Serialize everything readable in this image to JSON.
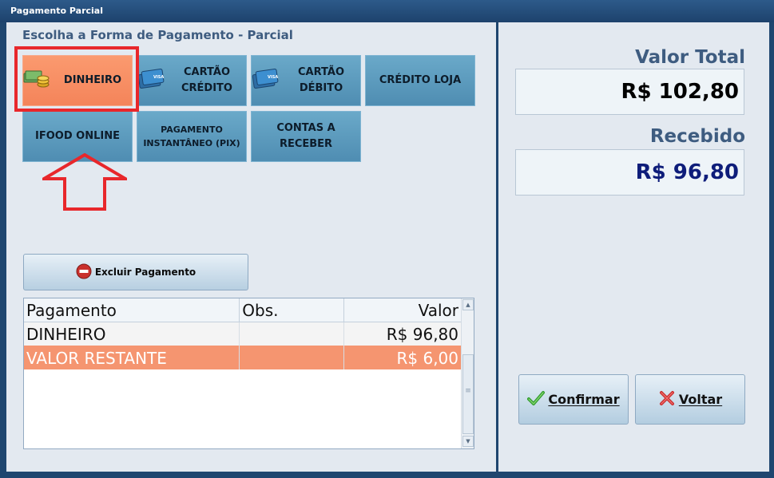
{
  "window": {
    "title": "Pagamento Parcial"
  },
  "section_title": "Escolha a Forma de Pagamento - Parcial",
  "payment_methods": [
    {
      "label": "DINHEIRO",
      "icon": "cash-coins-icon",
      "selected": true
    },
    {
      "label": "CARTÃO CRÉDITO",
      "icon": "credit-card-icon",
      "selected": false
    },
    {
      "label": "CARTÃO DÉBITO",
      "icon": "debit-card-icon",
      "selected": false
    },
    {
      "label": "CRÉDITO LOJA",
      "selected": false
    },
    {
      "label": "IFOOD ONLINE",
      "selected": false
    },
    {
      "label": "PAGAMENTO INSTANTÂNEO (PIX)",
      "selected": false
    },
    {
      "label": "CONTAS A RECEBER",
      "selected": false
    }
  ],
  "excluir_button": {
    "label": "Excluir Pagamento",
    "icon": "remove-circle-icon"
  },
  "table": {
    "headers": [
      "Pagamento",
      "Obs.",
      "Valor"
    ],
    "rows": [
      {
        "pagamento": "DINHEIRO",
        "obs": "",
        "valor": "R$ 96,80"
      },
      {
        "pagamento": "VALOR RESTANTE",
        "obs": "",
        "valor": "R$ 6,00"
      }
    ]
  },
  "totals": {
    "valor_total_label": "Valor Total",
    "valor_total": "R$ 102,80",
    "recebido_label": "Recebido",
    "recebido": "R$ 96,80"
  },
  "actions": {
    "confirm_label": "Confirmar",
    "back_label": "Voltar"
  },
  "colors": {
    "selected_button": "#f4845a",
    "button": "#5b97bd",
    "highlight": "#e8272b",
    "remaining_row": "#f59570",
    "received_value": "#0e1d7a"
  }
}
